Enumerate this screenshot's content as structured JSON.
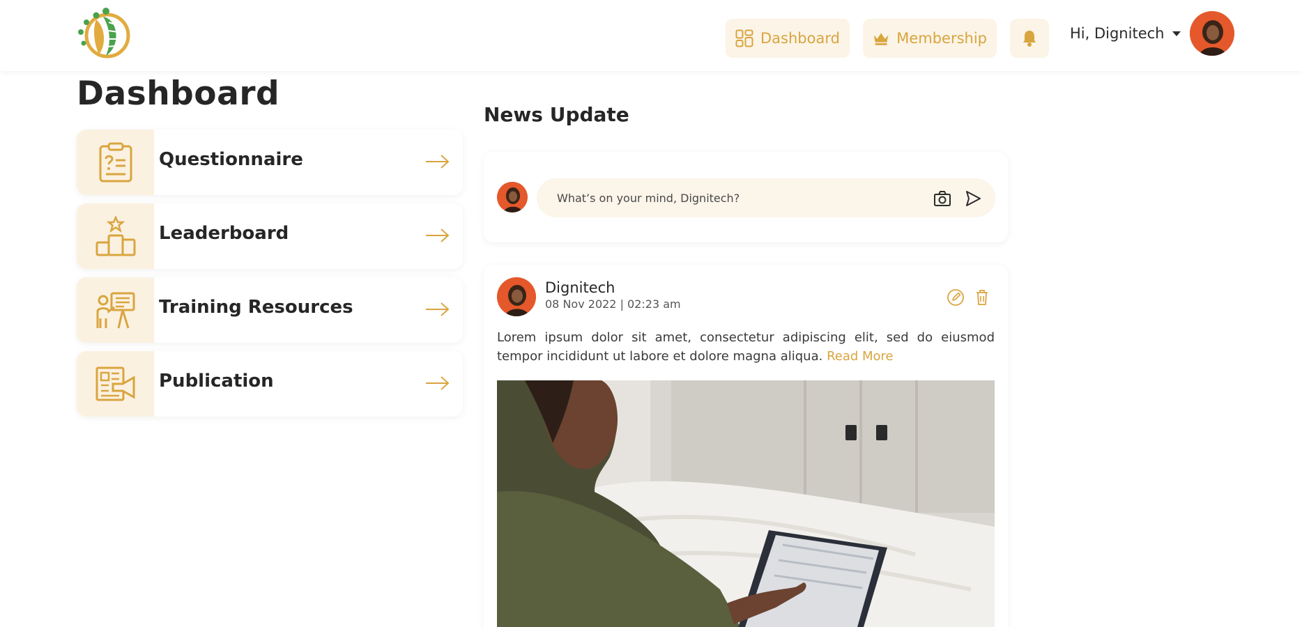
{
  "header": {
    "nav": {
      "dashboard_label": "Dashboard",
      "membership_label": "Membership"
    },
    "greeting": "Hi, Dignitech",
    "accent_color": "#d9a53f",
    "accent_bg": "#fbf4e7"
  },
  "page": {
    "title": "Dashboard"
  },
  "menu": [
    {
      "label": "Questionnaire",
      "icon": "clipboard-question-icon"
    },
    {
      "label": "Leaderboard",
      "icon": "podium-star-icon"
    },
    {
      "label": "Training Resources",
      "icon": "presenter-board-icon"
    },
    {
      "label": "Publication",
      "icon": "newspaper-megaphone-icon"
    }
  ],
  "news": {
    "title": "News Update",
    "composer": {
      "placeholder": "What’s on your mind, Dignitech?"
    },
    "post": {
      "author": "Dignitech",
      "date": "08 Nov 2022 | 02:23 am",
      "body": "Lorem ipsum dolor sit amet, consectetur adipiscing elit, sed do eiusmod tempor incididunt ut labore et dolore magna aliqua.",
      "read_more": "Read More"
    }
  }
}
